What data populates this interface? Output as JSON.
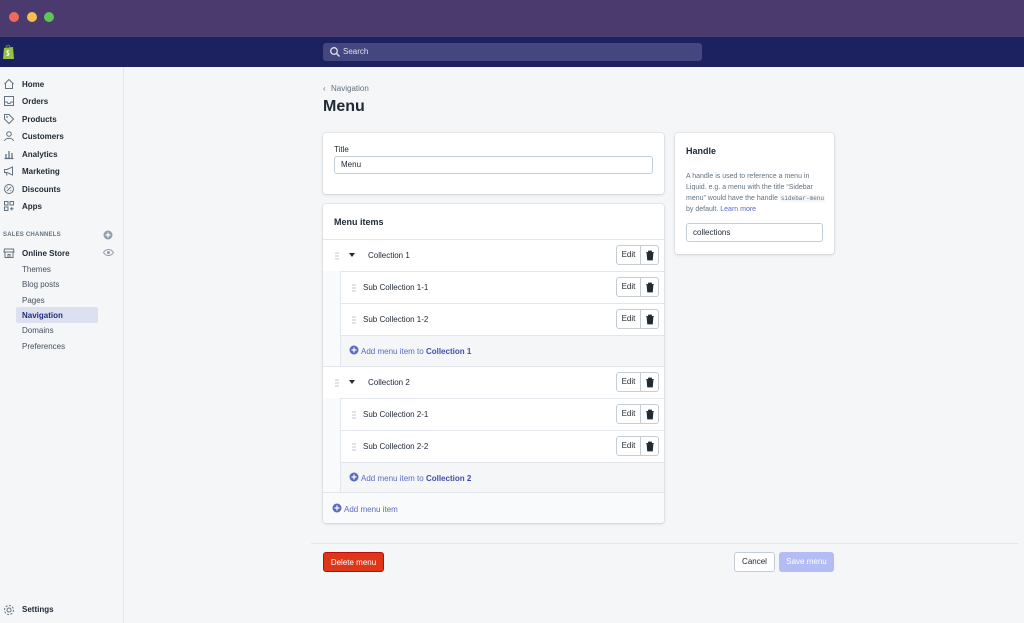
{
  "window": {
    "controls": [
      "close",
      "minimize",
      "maximize"
    ],
    "colors": {
      "close": "#ef6a5e",
      "minimize": "#f4bf4f",
      "maximize": "#61c454",
      "titlebar": "#4b3a6e",
      "topbar": "#1c2260"
    }
  },
  "topbar": {
    "logo_icon": "shopify-bag-icon",
    "search": {
      "placeholder": "Search",
      "icon": "search-icon"
    }
  },
  "sidebar": {
    "items": [
      {
        "label": "Home",
        "icon": "home-icon"
      },
      {
        "label": "Orders",
        "icon": "inbox-icon"
      },
      {
        "label": "Products",
        "icon": "tag-icon"
      },
      {
        "label": "Customers",
        "icon": "person-icon"
      },
      {
        "label": "Analytics",
        "icon": "bar-chart-icon"
      },
      {
        "label": "Marketing",
        "icon": "megaphone-icon"
      },
      {
        "label": "Discounts",
        "icon": "discount-icon"
      },
      {
        "label": "Apps",
        "icon": "apps-icon"
      }
    ],
    "sales_channels_label": "SALES CHANNELS",
    "online_store": {
      "label": "Online Store",
      "sub_items": [
        "Themes",
        "Blog posts",
        "Pages",
        "Navigation",
        "Domains",
        "Preferences"
      ],
      "active": "Navigation"
    },
    "settings_label": "Settings"
  },
  "main": {
    "breadcrumb": "Navigation",
    "page_title": "Menu",
    "title_card": {
      "label": "Title",
      "value": "Menu"
    },
    "menu_items": {
      "heading": "Menu items",
      "groups": [
        {
          "name": "Collection 1",
          "children": [
            "Sub Collection 1-1",
            "Sub Collection 1-2"
          ],
          "add_prefix": "Add menu item to",
          "add_target": "Collection 1"
        },
        {
          "name": "Collection 2",
          "children": [
            "Sub Collection 2-1",
            "Sub Collection 2-2"
          ],
          "add_prefix": "Add menu item to",
          "add_target": "Collection 2"
        }
      ],
      "edit_label": "Edit",
      "add_menu_item": "Add menu item"
    },
    "handle_card": {
      "heading": "Handle",
      "desc_before": "A handle is used to reference a menu in Liquid. e.g. a menu with the title “Sidebar menu” would have the handle",
      "desc_code": "sidebar-menu",
      "desc_after": "by default.",
      "link": "Learn more",
      "value": "collections"
    },
    "actions": {
      "delete": "Delete menu",
      "cancel": "Cancel",
      "save": "Save menu",
      "delete_color": "#de3618",
      "save_color": "#b3bcf5"
    }
  }
}
